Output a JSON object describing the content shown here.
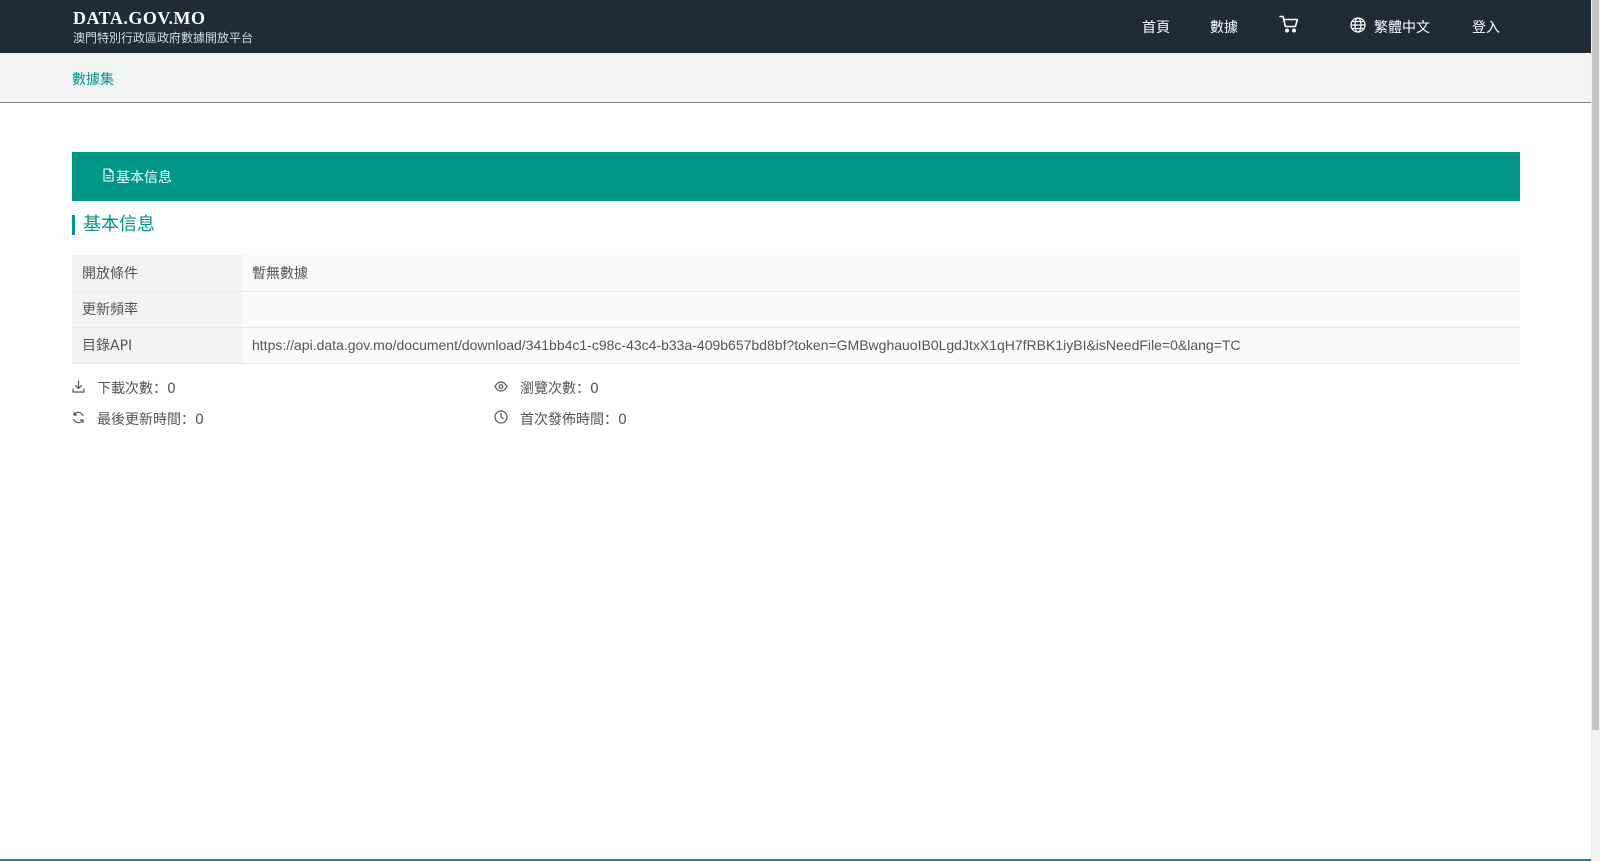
{
  "header": {
    "brand_title": "DATA.GOV.MO",
    "brand_subtitle": "澳門特別行政區政府數據開放平台",
    "nav": {
      "home": "首頁",
      "data": "數據",
      "cart_icon": "cart-icon",
      "language_icon": "globe-icon",
      "language": "繁體中文",
      "login": "登入"
    }
  },
  "breadcrumb": {
    "datasets": "數據集"
  },
  "tabs": [
    {
      "label": "基本信息",
      "icon": "document-icon",
      "active": true
    }
  ],
  "section": {
    "title": "基本信息"
  },
  "info_table": [
    {
      "key": "開放條件",
      "value": "暫無數據"
    },
    {
      "key": "更新頻率",
      "value": ""
    },
    {
      "key": "目錄API",
      "value": "https://api.data.gov.mo/document/download/341bb4c1-c98c-43c4-b33a-409b657bd8bf?token=GMBwghauoIB0LgdJtxX1qH7fRBK1iyBI&isNeedFile=0&lang=TC"
    }
  ],
  "stats": {
    "downloads": "下載次數：0",
    "views": "瀏覽次數：0",
    "last_updated": "最後更新時間：0",
    "first_published": "首次發佈時間：0"
  },
  "colors": {
    "accent": "#009688",
    "header_bg": "#222a33",
    "breadcrumb_bg": "#f2f4f4"
  }
}
